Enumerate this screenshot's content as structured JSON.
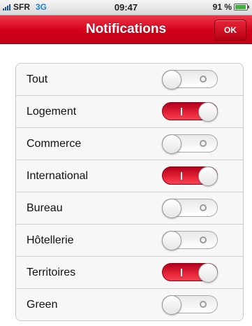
{
  "status_bar": {
    "carrier": "SFR",
    "network": "3G",
    "time": "09:47",
    "battery": "91 %",
    "battery_level": 0.91,
    "signal_icon": "signal-bars-icon",
    "battery_icon": "battery-icon"
  },
  "nav": {
    "title": "Notifications",
    "ok_label": "OK"
  },
  "colors": {
    "accent": "#d2001a",
    "switch_on": "#e8243a",
    "network": "#1a7fd0",
    "battery": "#3ab53a"
  },
  "settings": [
    {
      "label": "Tout",
      "on": false
    },
    {
      "label": "Logement",
      "on": true
    },
    {
      "label": "Commerce",
      "on": false
    },
    {
      "label": "International",
      "on": true
    },
    {
      "label": "Bureau",
      "on": false
    },
    {
      "label": "Hôtellerie",
      "on": false
    },
    {
      "label": "Territoires",
      "on": true
    },
    {
      "label": "Green",
      "on": false
    }
  ]
}
